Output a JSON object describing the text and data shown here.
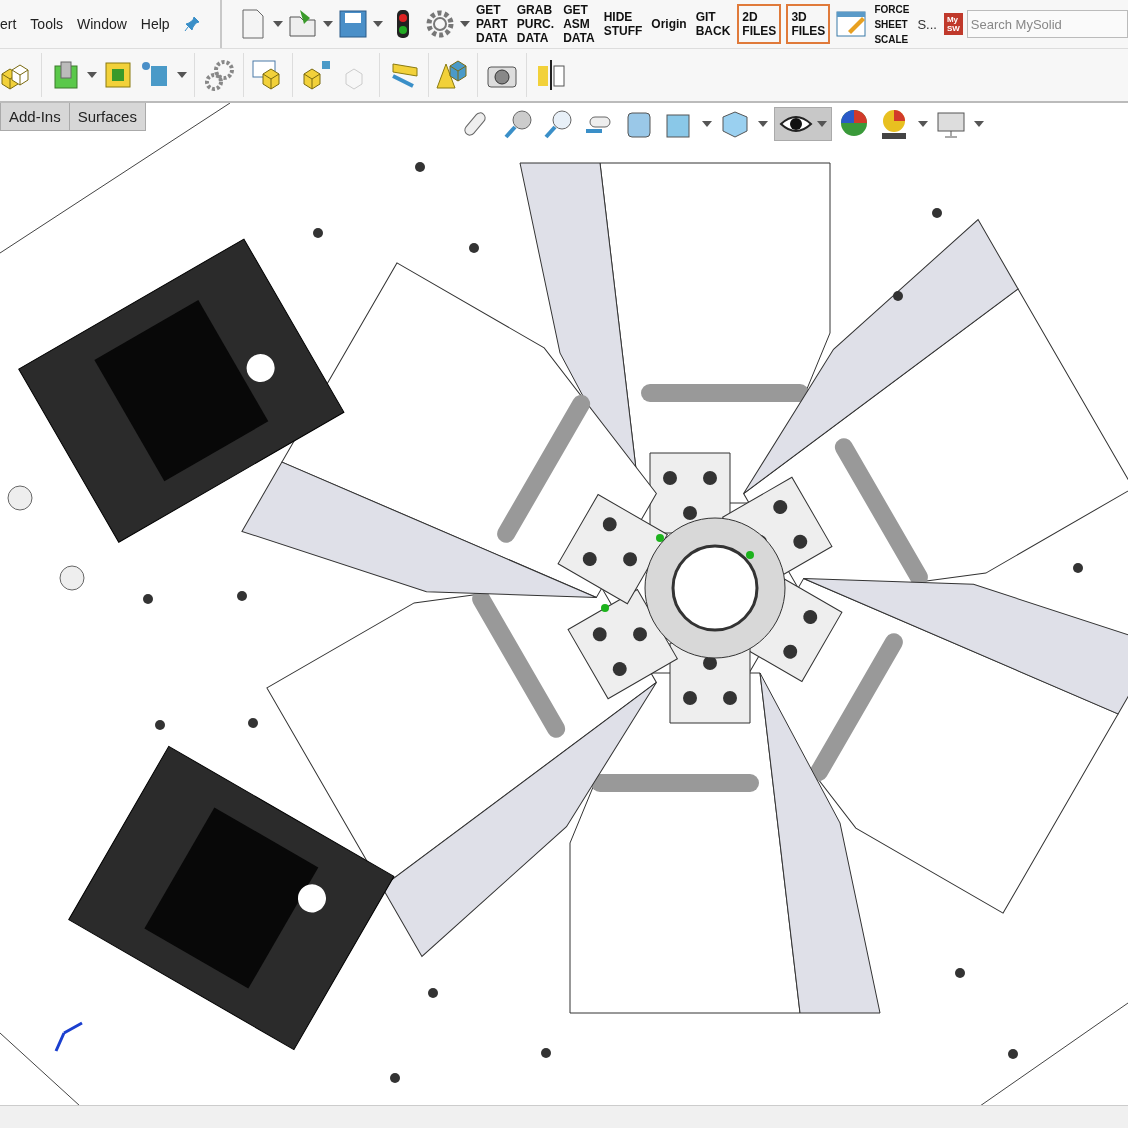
{
  "menu": [
    "ert",
    "Tools",
    "Window",
    "Help"
  ],
  "toolbar_text_buttons": [
    {
      "label": "GET\nPART\nDATA",
      "kind": "plain"
    },
    {
      "label": "GRAB\nPURC.\nDATA",
      "kind": "plain"
    },
    {
      "label": "GET\nASM\nDATA",
      "kind": "plain"
    },
    {
      "label": "HIDE\nSTUFF",
      "kind": "plain"
    },
    {
      "label": "Origin",
      "kind": "plain"
    },
    {
      "label": "GIT\nBACK",
      "kind": "plain"
    },
    {
      "label": "2D\nFILES",
      "kind": "framed"
    },
    {
      "label": "3D\nFILES",
      "kind": "framed"
    }
  ],
  "force_button": {
    "label": "FORCE\nSHEET\nSCALE"
  },
  "overflow_label": "S...",
  "search": {
    "placeholder": "Search MySolid",
    "logo": "My\nSW"
  },
  "tabs": [
    {
      "label": "Add-Ins",
      "selected": false
    },
    {
      "label": "Surfaces",
      "selected": false
    }
  ],
  "view_toolbar": {
    "display_style_active": true
  }
}
